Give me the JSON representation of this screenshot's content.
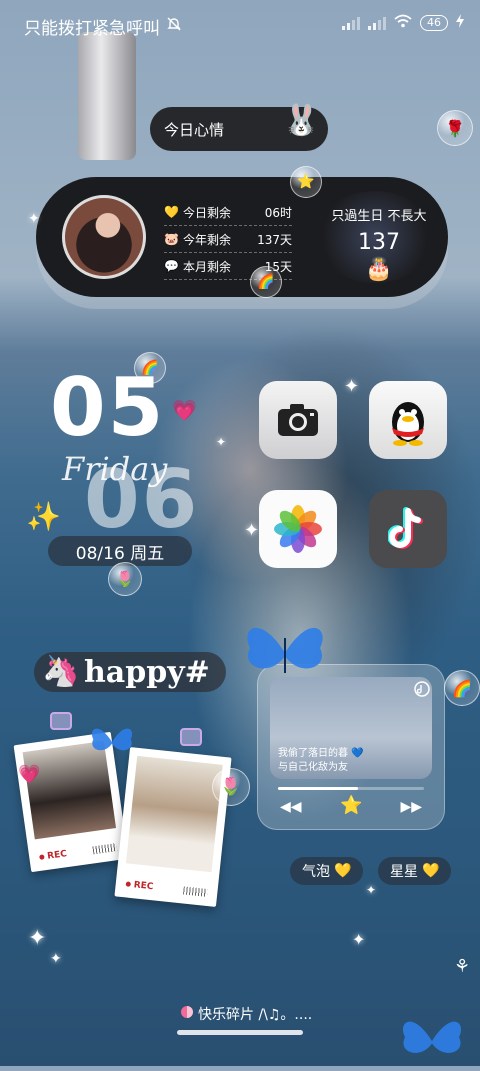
{
  "status_bar": {
    "carrier_text": "只能拨打紧急呼叫",
    "battery": "46",
    "silent_icon": "bell-off-icon",
    "wifi_icon": "wifi-icon",
    "charging_icon": "bolt-icon"
  },
  "mood_widget": {
    "label": "今日心情",
    "sticker": "🐰"
  },
  "countdown": {
    "rows": [
      {
        "icon": "💛",
        "label": "今日剩余",
        "value": "06时"
      },
      {
        "icon": "🐷",
        "label": "今年剩余",
        "value": "137天"
      },
      {
        "icon": "💬",
        "label": "本月剩余",
        "value": "15天"
      }
    ],
    "birthday_title": "只過生日 不長大",
    "birthday_days": "137",
    "cake": "🎂"
  },
  "clock": {
    "hour": "05",
    "minute": "06",
    "weekday": "Friday",
    "date": "08/16 周五"
  },
  "apps": [
    {
      "name": "camera"
    },
    {
      "name": "qq"
    },
    {
      "name": "photos"
    },
    {
      "name": "tiktok"
    }
  ],
  "happy_widget": {
    "text": "happy#",
    "sticker": "🦄"
  },
  "polaroids": [
    {
      "rec": "REC"
    },
    {
      "rec": "REC"
    }
  ],
  "music_widget": {
    "lyric_line1": "我偷了落日的暮 💙",
    "lyric_line2": "与自己化敌为友",
    "progress": 0.55,
    "prev": "◀◀",
    "next": "▶▶",
    "center": "⭐"
  },
  "tags": [
    {
      "label": "气泡",
      "icon": "💛"
    },
    {
      "label": "星星",
      "icon": "💛"
    }
  ],
  "bottom": {
    "text": "快乐碎片 /\\♫。...."
  },
  "colors": {
    "widget_dark": "#141416",
    "accent_blue": "#2e7de8",
    "rec_red": "#c0262b"
  }
}
